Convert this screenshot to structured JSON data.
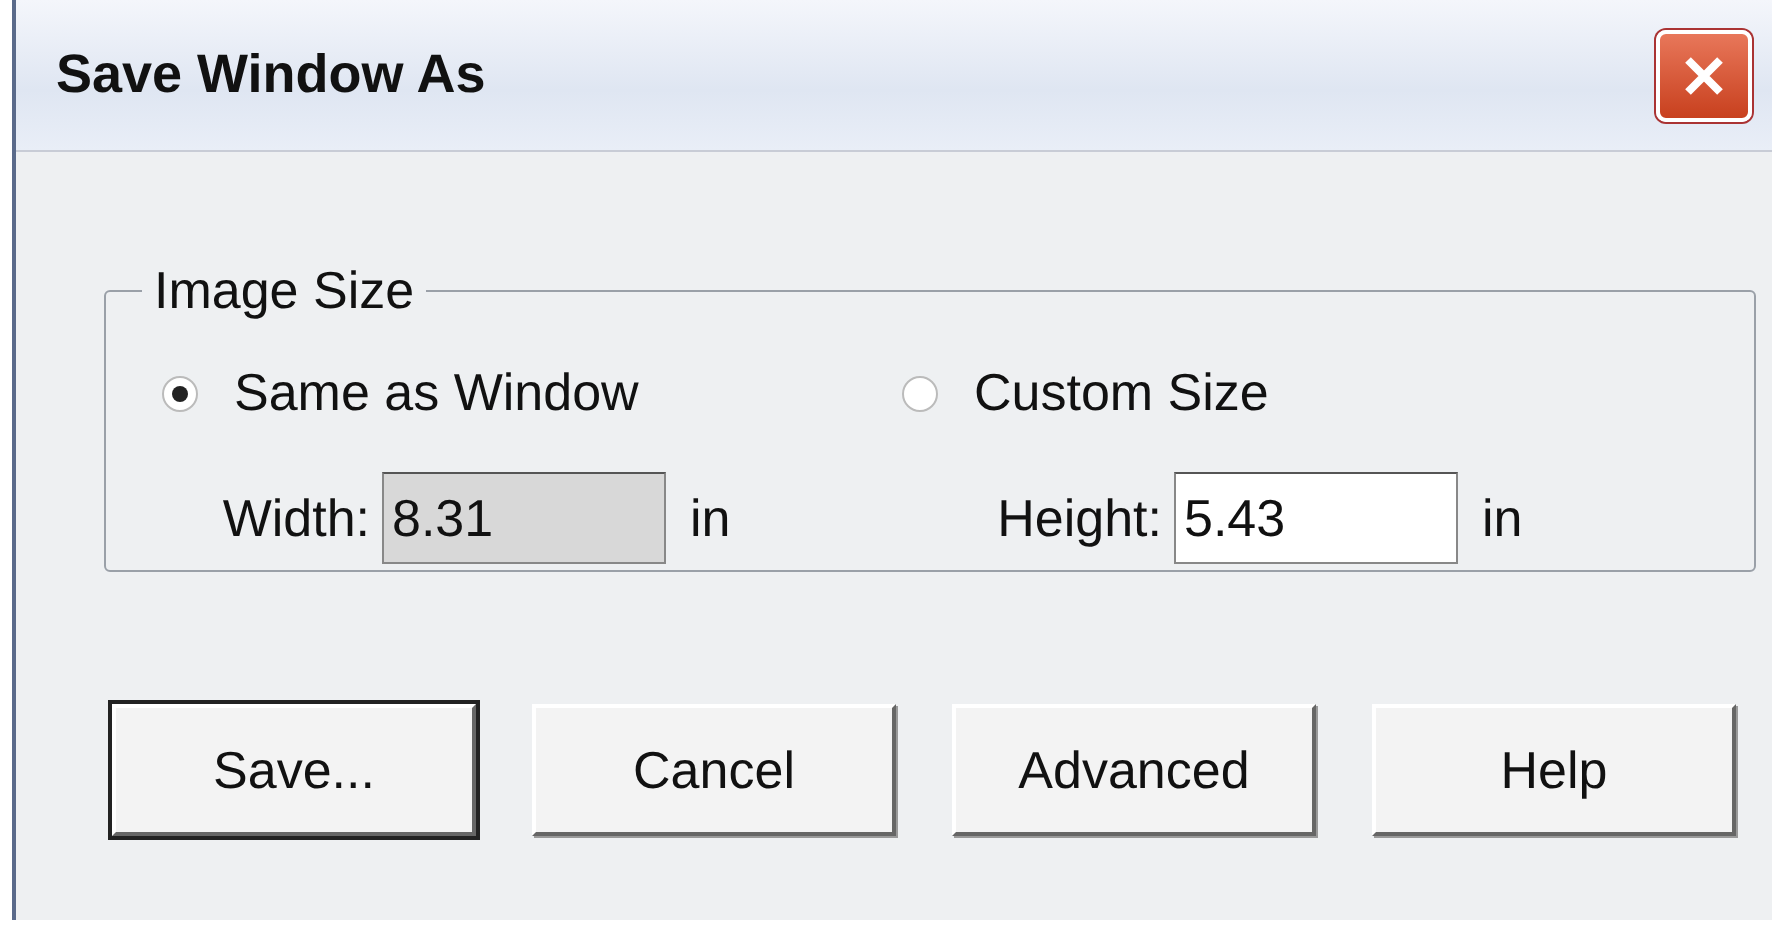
{
  "window": {
    "title": "Save Window As"
  },
  "image_size": {
    "label": "Image Size",
    "options": [
      {
        "label": "Same as Window",
        "selected": true
      },
      {
        "label": "Custom Size",
        "selected": false
      }
    ],
    "fields": [
      {
        "label": "Width:",
        "value": "8.31",
        "unit": "in",
        "focused": true
      },
      {
        "label": "Height:",
        "value": "5.43",
        "unit": "in",
        "focused": false
      }
    ]
  },
  "buttons": [
    {
      "label": "Save...",
      "default": true
    },
    {
      "label": "Cancel",
      "default": false
    },
    {
      "label": "Advanced",
      "default": false
    },
    {
      "label": "Help",
      "default": false
    }
  ]
}
